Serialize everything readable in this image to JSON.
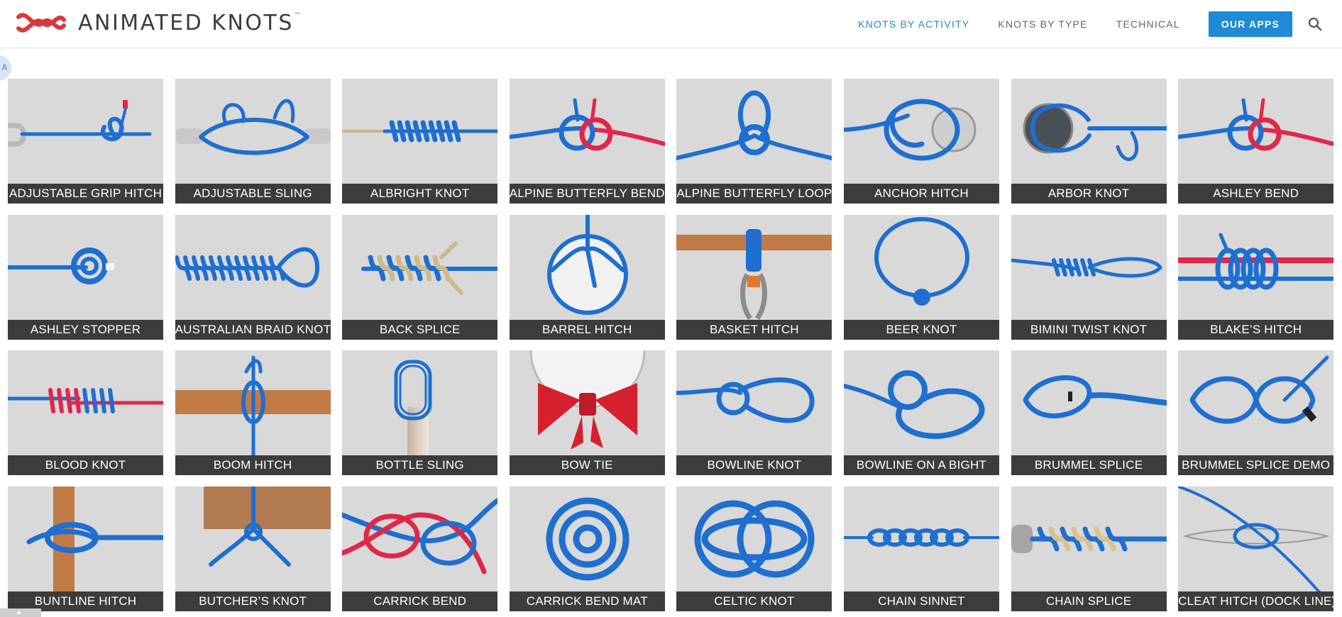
{
  "brand": {
    "name": "ANIMATED KNOTS",
    "tm": "™"
  },
  "nav": {
    "items": [
      {
        "label": "KNOTS BY ACTIVITY",
        "active": true
      },
      {
        "label": "KNOTS BY TYPE",
        "active": false
      },
      {
        "label": "TECHNICAL",
        "active": false
      }
    ],
    "apps_label": "OUR APPS",
    "search_icon": "search-icon"
  },
  "colors": {
    "accent": "#1f8ad6",
    "tile_bg": "#d9d9d9",
    "label_bg": "#3c3c3c",
    "rope_blue": "#1e6fd0",
    "rope_red": "#e0274a",
    "rope_tan": "#cdb98a",
    "wood": "#c07a45"
  },
  "knots": [
    {
      "label": "ADJUSTABLE GRIP HITCH",
      "art": "hitch-ring",
      "icon": "knot-adjustable-grip-hitch-icon"
    },
    {
      "label": "ADJUSTABLE SLING",
      "art": "sling",
      "icon": "knot-adjustable-sling-icon"
    },
    {
      "label": "ALBRIGHT KNOT",
      "art": "wrap-tan",
      "icon": "knot-albright-icon"
    },
    {
      "label": "ALPINE BUTTERFLY BEND",
      "art": "bend-red",
      "icon": "knot-alpine-butterfly-bend-icon"
    },
    {
      "label": "ALPINE BUTTERFLY LOOP",
      "art": "loop-up",
      "icon": "knot-alpine-butterfly-loop-icon"
    },
    {
      "label": "ANCHOR HITCH",
      "art": "disc-loop",
      "icon": "knot-anchor-hitch-icon"
    },
    {
      "label": "ARBOR KNOT",
      "art": "disc-dark",
      "icon": "knot-arbor-icon"
    },
    {
      "label": "ASHLEY BEND",
      "art": "bend-red",
      "icon": "knot-ashley-bend-icon"
    },
    {
      "label": "ASHLEY STOPPER",
      "art": "stopper",
      "icon": "knot-ashley-stopper-icon"
    },
    {
      "label": "AUSTRALIAN BRAID KNOT",
      "art": "braid-loop",
      "icon": "knot-australian-braid-icon"
    },
    {
      "label": "BACK SPLICE",
      "art": "splice-tan",
      "icon": "knot-back-splice-icon"
    },
    {
      "label": "BARREL HITCH",
      "art": "barrel",
      "icon": "knot-barrel-hitch-icon"
    },
    {
      "label": "BASKET HITCH",
      "art": "pole-carabiner",
      "icon": "knot-basket-hitch-icon"
    },
    {
      "label": "BEER KNOT",
      "art": "ring",
      "icon": "knot-beer-icon"
    },
    {
      "label": "BIMINI TWIST KNOT",
      "art": "twist-loop",
      "icon": "knot-bimini-twist-icon"
    },
    {
      "label": "BLAKE’S HITCH",
      "art": "red-line-wrap",
      "icon": "knot-blakes-hitch-icon"
    },
    {
      "label": "BLOOD KNOT",
      "art": "blood",
      "icon": "knot-blood-icon"
    },
    {
      "label": "BOOM HITCH",
      "art": "pole-vertical",
      "icon": "knot-boom-hitch-icon"
    },
    {
      "label": "BOTTLE SLING",
      "art": "bottle",
      "icon": "knot-bottle-sling-icon"
    },
    {
      "label": "BOW TIE",
      "art": "bowtie",
      "icon": "knot-bow-tie-icon"
    },
    {
      "label": "BOWLINE KNOT",
      "art": "bowline",
      "icon": "knot-bowline-icon"
    },
    {
      "label": "BOWLINE ON A BIGHT",
      "art": "bowline-bight",
      "icon": "knot-bowline-bight-icon"
    },
    {
      "label": "BRUMMEL SPLICE",
      "art": "brummel",
      "icon": "knot-brummel-splice-icon"
    },
    {
      "label": "BRUMMEL SPLICE DEMO",
      "art": "brummel8",
      "icon": "knot-brummel-demo-icon"
    },
    {
      "label": "BUNTLINE HITCH",
      "art": "vpole-hitch",
      "icon": "knot-buntline-hitch-icon"
    },
    {
      "label": "BUTCHER’S KNOT",
      "art": "block",
      "icon": "knot-butchers-icon"
    },
    {
      "label": "CARRICK BEND",
      "art": "carrick",
      "icon": "knot-carrick-bend-icon"
    },
    {
      "label": "CARRICK BEND MAT",
      "art": "mat-round",
      "icon": "knot-carrick-mat-icon"
    },
    {
      "label": "CELTIC KNOT",
      "art": "celtic",
      "icon": "knot-celtic-icon"
    },
    {
      "label": "CHAIN SINNET",
      "art": "chain",
      "icon": "knot-chain-sinnet-icon"
    },
    {
      "label": "CHAIN SPLICE",
      "art": "chain-splice",
      "icon": "knot-chain-splice-icon"
    },
    {
      "label": "CLEAT HITCH (DOCK LINE)",
      "art": "cleat",
      "icon": "knot-cleat-hitch-icon"
    }
  ]
}
